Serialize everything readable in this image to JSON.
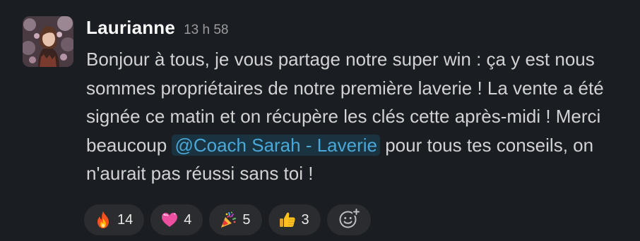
{
  "message": {
    "author": "Laurianne",
    "timestamp": "13 h 58",
    "text_before_mention": "Bonjour à tous, je vous partage notre super win : ça y est nous sommes propriétaires de notre première laverie ! La vente a été signée ce matin et on récupère les clés cette après-midi ! Merci beaucoup ",
    "mention": "@Coach Sarah - Laverie",
    "text_after_mention": " pour tous tes conseils, on n'aurait pas réussi sans toi !"
  },
  "reactions": [
    {
      "icon": "fire-icon",
      "count": "14"
    },
    {
      "icon": "pink-heart-icon",
      "count": "4"
    },
    {
      "icon": "party-popper-icon",
      "count": "5"
    },
    {
      "icon": "thumbs-up-icon",
      "count": "3"
    }
  ],
  "add_reaction_icon": "add-reaction-icon",
  "colors": {
    "background": "#1a1d21",
    "mention_text": "#4aa8d8",
    "reaction_pill": "#2a2c30"
  }
}
